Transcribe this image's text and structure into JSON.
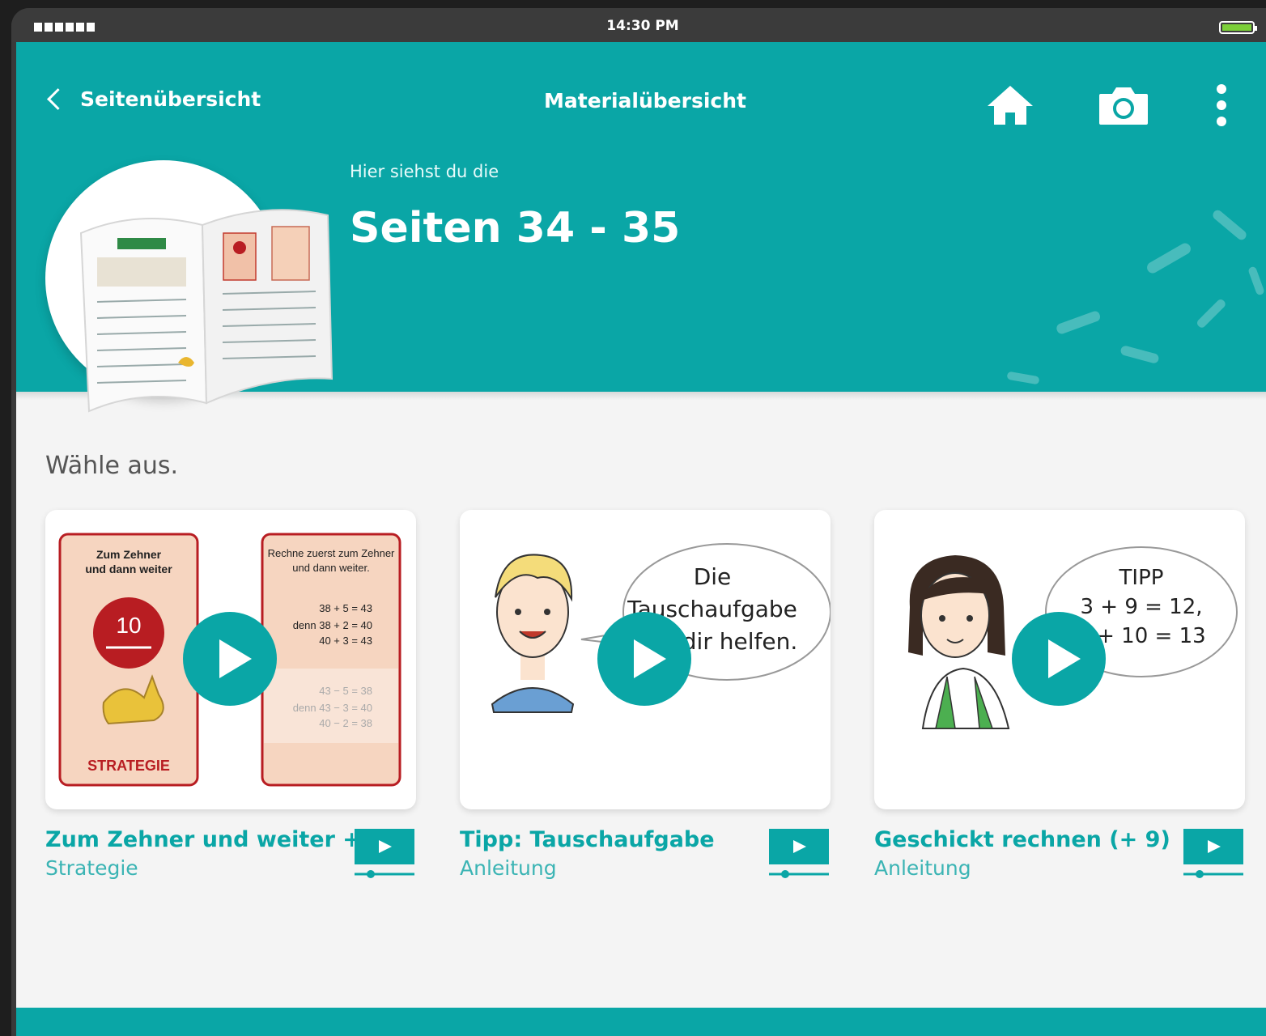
{
  "status_bar": {
    "time": "14:30 PM",
    "battery_level": 1.0
  },
  "nav": {
    "back_label": "Seitenübersicht",
    "title": "Materialübersicht"
  },
  "header": {
    "subtitle": "Hier siehst du die",
    "title": "Seiten 34 - 35"
  },
  "prompt": "Wähle aus.",
  "items": [
    {
      "title": "Zum Zehner und weiter +",
      "subtitle": "Strategie",
      "thumb": {
        "left_heading": "Zum Zehner\nund dann weiter",
        "badge": "10",
        "footer": "STRATEGIE",
        "right_heading": "Rechne zuerst zum Zehner\nund dann weiter.",
        "eq1": "38 + 5 = 43",
        "eq2": "denn 38 + 2 = 40",
        "eq3": "40 + 3 = 43",
        "eq4": "43 − 5 = 38",
        "eq5": "denn 43 − 3 = 40",
        "eq6": "40 − 2 = 38"
      }
    },
    {
      "title": "Tipp: Tauschaufgabe",
      "subtitle": "Anleitung",
      "thumb": {
        "bubble_line1": "Die",
        "bubble_line2": "Tauschaufgabe",
        "bubble_line3": "dir helfen."
      }
    },
    {
      "title": "Geschickt rechnen (+ 9)",
      "subtitle": "Anleitung",
      "thumb": {
        "bubble_line1": "TIPP",
        "bubble_line2": "3 + 9 = 12,",
        "bubble_line3": "3 + 10 = 13"
      }
    }
  ],
  "colors": {
    "primary": "#0aa6a6",
    "background": "#f4f4f4",
    "thumb_red": "#b81d22",
    "thumb_peach": "#f6d5c0"
  }
}
